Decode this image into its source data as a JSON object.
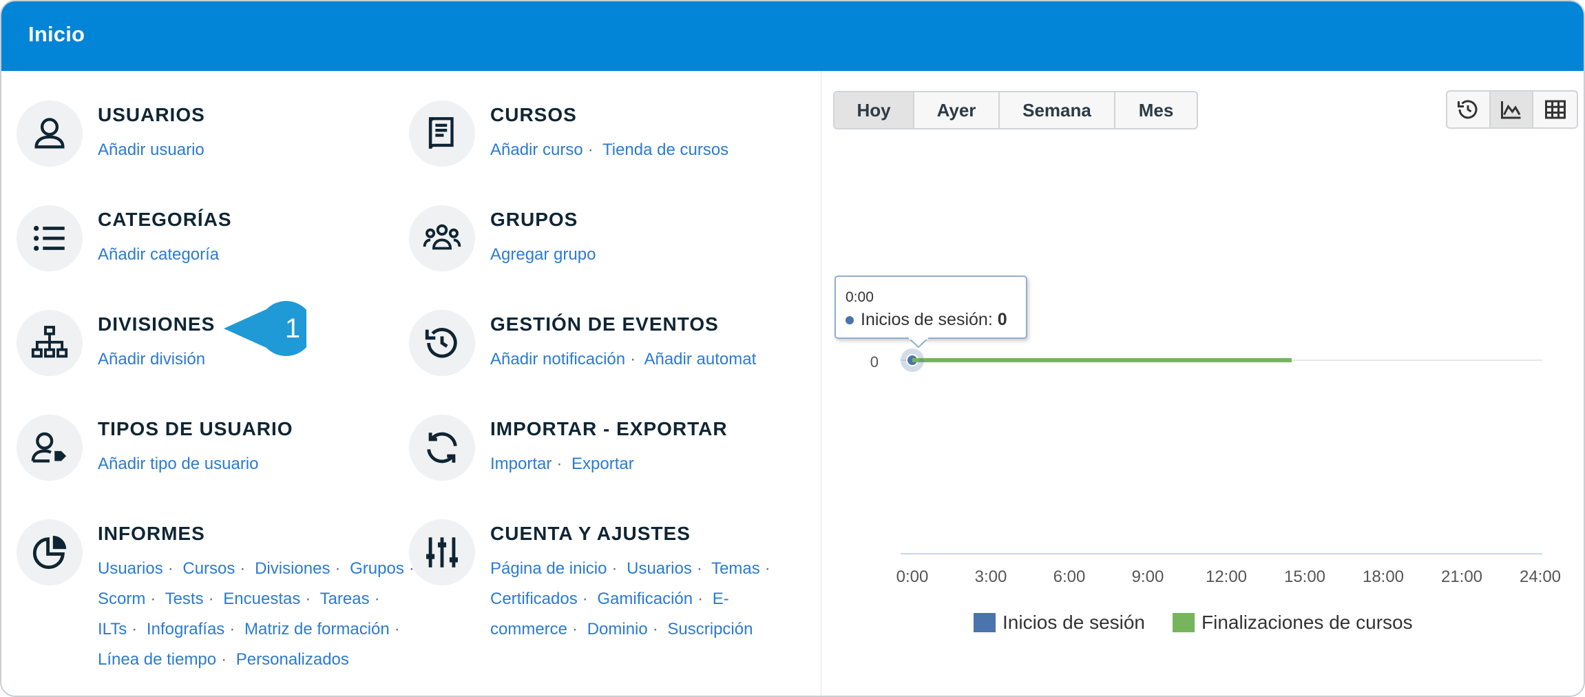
{
  "header": {
    "title": "Inicio"
  },
  "sections": [
    {
      "name": "usuarios",
      "icon": "user-icon",
      "title": "USUARIOS",
      "links": [
        "Añadir usuario"
      ]
    },
    {
      "name": "cursos",
      "icon": "book-icon",
      "title": "CURSOS",
      "links": [
        "Añadir curso",
        "Tienda de cursos"
      ]
    },
    {
      "name": "categorias",
      "icon": "list-icon",
      "title": "CATEGORÍAS",
      "links": [
        "Añadir categoría"
      ]
    },
    {
      "name": "grupos",
      "icon": "group-icon",
      "title": "GRUPOS",
      "links": [
        "Agregar grupo"
      ]
    },
    {
      "name": "divisiones",
      "icon": "hierarchy-icon",
      "title": "DIVISIONES",
      "links": [
        "Añadir división"
      ]
    },
    {
      "name": "gestion-eventos",
      "icon": "history-icon",
      "title": "GESTIÓN DE EVENTOS",
      "links": [
        "Añadir notificación",
        "Añadir automat"
      ]
    },
    {
      "name": "tipos-usuario",
      "icon": "user-tag-icon",
      "title": "TIPOS DE USUARIO",
      "links": [
        "Añadir tipo de usuario"
      ]
    },
    {
      "name": "importar-exportar",
      "icon": "sync-icon",
      "title": "IMPORTAR - EXPORTAR",
      "links": [
        "Importar",
        "Exportar"
      ]
    },
    {
      "name": "informes",
      "icon": "pie-chart-icon",
      "title": "INFORMES",
      "links": [
        "Usuarios",
        "Cursos",
        "Divisiones",
        "Grupos",
        "Scorm",
        "Tests",
        "Encuestas",
        "Tareas",
        "ILTs",
        "Infografías",
        "Matriz de formación",
        "Línea de tiempo",
        "Personalizados"
      ]
    },
    {
      "name": "cuenta-ajustes",
      "icon": "sliders-icon",
      "title": "CUENTA Y AJUSTES",
      "links": [
        "Página de inicio",
        "Usuarios",
        "Temas",
        "Certificados",
        "Gamificación",
        "E-commerce",
        "Dominio",
        "Suscripción"
      ]
    }
  ],
  "callout": {
    "number": "1"
  },
  "period_tabs": [
    {
      "label": "Hoy",
      "active": true
    },
    {
      "label": "Ayer",
      "active": false
    },
    {
      "label": "Semana",
      "active": false
    },
    {
      "label": "Mes",
      "active": false
    }
  ],
  "view_buttons": [
    {
      "icon": "history-icon",
      "active": false
    },
    {
      "icon": "area-chart-icon",
      "active": true
    },
    {
      "icon": "table-grid-icon",
      "active": false
    }
  ],
  "tooltip": {
    "time": "0:00",
    "series": "Inicios de sesión",
    "separator": ":",
    "value": "0"
  },
  "chart_data": {
    "type": "line",
    "x_ticks": [
      "0:00",
      "3:00",
      "6:00",
      "9:00",
      "12:00",
      "15:00",
      "18:00",
      "21:00",
      "24:00"
    ],
    "y_ticks": [
      "0"
    ],
    "xlim": [
      0,
      24
    ],
    "series": [
      {
        "name": "Inicios de sesión",
        "color": "#4b73ad",
        "x": [
          0
        ],
        "y": [
          0
        ]
      },
      {
        "name": "Finalizaciones de cursos",
        "color": "#76b55b",
        "x": [
          0,
          14.5
        ],
        "y": [
          0,
          0
        ]
      }
    ]
  },
  "colors": {
    "header": "#0284d7",
    "link": "#2b7bd1",
    "callout": "#1f9ad6"
  }
}
